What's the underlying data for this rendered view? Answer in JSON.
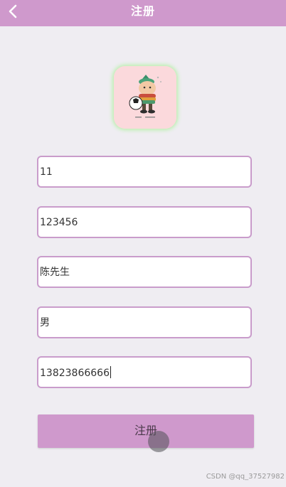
{
  "header": {
    "title": "注册",
    "back_icon": "chevron-left-icon",
    "background": "#cf99cc"
  },
  "avatar": {
    "icon": "cartoon-avatar-image"
  },
  "form": {
    "fields": [
      {
        "value": "11"
      },
      {
        "value": "123456"
      },
      {
        "value": "陈先生"
      },
      {
        "value": "男"
      },
      {
        "value": "13823866666"
      }
    ],
    "submit_label": "注册"
  },
  "watermark": "CSDN @qq_37527982"
}
